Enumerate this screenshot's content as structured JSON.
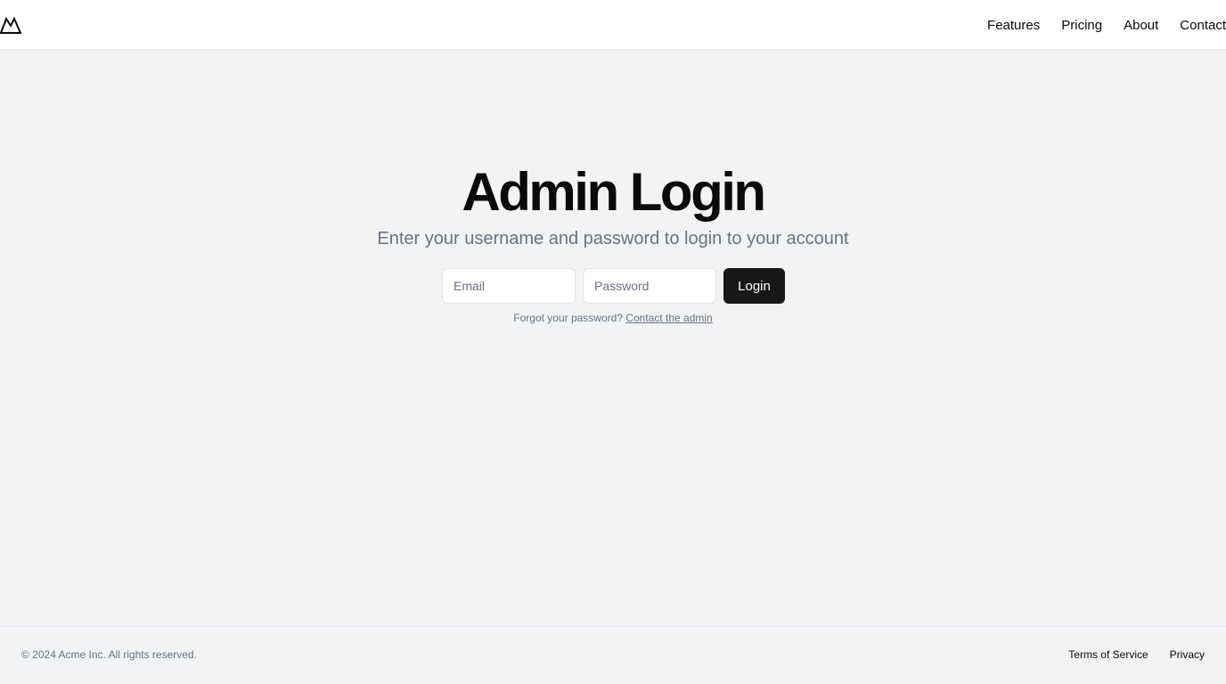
{
  "header": {
    "logo_icon": "mountain-icon",
    "nav": [
      {
        "label": "Features"
      },
      {
        "label": "Pricing"
      },
      {
        "label": "About"
      },
      {
        "label": "Contact"
      }
    ]
  },
  "main": {
    "title": "Admin Login",
    "subtitle": "Enter your username and password to login to your account",
    "email_placeholder": "Email",
    "password_placeholder": "Password",
    "login_label": "Login",
    "forgot_text": "Forgot your password?",
    "contact_link": "Contact the admin"
  },
  "footer": {
    "copyright": "© 2024 Acme Inc. All rights reserved.",
    "links": [
      {
        "label": "Terms of Service"
      },
      {
        "label": "Privacy"
      }
    ]
  },
  "colors": {
    "background": "#f1f3f5",
    "header_bg": "#ffffff",
    "button_bg": "#18181b",
    "muted_text": "#6b7280"
  }
}
